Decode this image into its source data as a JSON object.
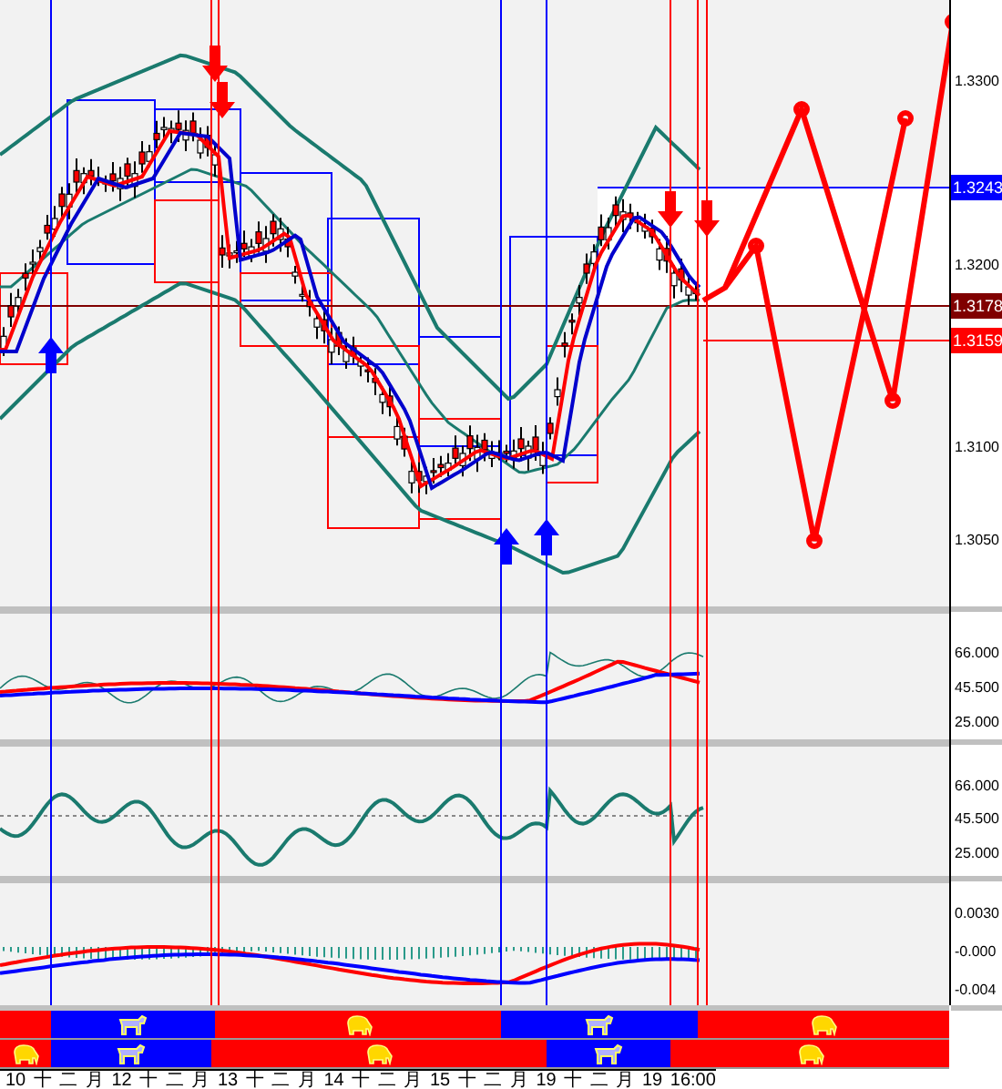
{
  "price_axis": {
    "ticks": [
      "1.3300",
      "1.3200",
      "1.3100",
      "1.3050"
    ],
    "tags": [
      {
        "text": "1.3243",
        "color": "#0000ff"
      },
      {
        "text": "1.3178",
        "color": "#800000"
      },
      {
        "text": "1.3159",
        "color": "#ff0000"
      }
    ]
  },
  "indicator_panels": [
    {
      "ticks": [
        "66.000",
        "45.500",
        "25.000"
      ]
    },
    {
      "ticks": [
        "66.000",
        "45.500",
        "25.000"
      ]
    },
    {
      "ticks": [
        "0.0030",
        "-0.000",
        "-0.004"
      ]
    }
  ],
  "signal_rows": [
    [
      {
        "kind": "plain",
        "color": "#ff0000"
      },
      {
        "kind": "bull",
        "color": "#0000ff"
      },
      {
        "kind": "bear",
        "color": "#ff0000"
      },
      {
        "kind": "bull",
        "color": "#0000ff"
      },
      {
        "kind": "bear",
        "color": "#ff0000"
      }
    ],
    [
      {
        "kind": "bear",
        "color": "#ff0000"
      },
      {
        "kind": "bull",
        "color": "#0000ff"
      },
      {
        "kind": "bear",
        "color": "#ff0000"
      },
      {
        "kind": "bull",
        "color": "#0000ff"
      },
      {
        "kind": "bear",
        "color": "#ff0000"
      }
    ]
  ],
  "time_axis": {
    "labels": [
      "10",
      "十",
      "二",
      "月",
      "12",
      "十",
      "二",
      "月",
      "13",
      "十",
      "二",
      "月",
      "14",
      "十",
      "二",
      "月",
      "15",
      "十",
      "二",
      "月",
      "19",
      "十",
      "二",
      "月",
      "19",
      "16:00"
    ]
  }
}
